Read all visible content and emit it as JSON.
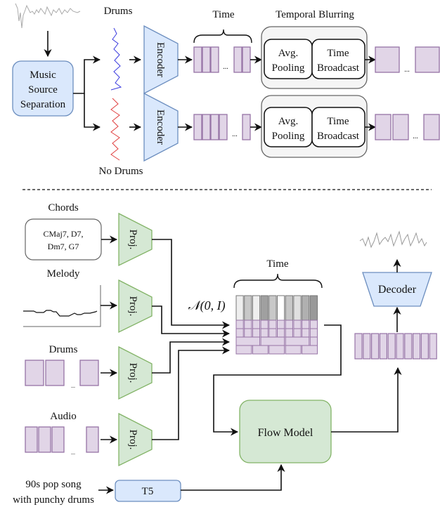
{
  "top": {
    "mixture_waveform": "waveform-gray",
    "separation_block": [
      "Music",
      "Source",
      "Separation"
    ],
    "drums_label": "Drums",
    "no_drums_label": "No Drums",
    "encoder_label": "Encoder",
    "time_label": "Time",
    "temporal_blurring_label": "Temporal Blurring",
    "avg_pooling": [
      "Avg.",
      "Pooling"
    ],
    "time_broadcast": [
      "Time",
      "Broadcast"
    ],
    "ellipsis": "...",
    "colors": {
      "drums_wave": "#3a3adf",
      "no_drums_wave": "#e04040"
    }
  },
  "bottom": {
    "chords_label": "Chords",
    "chords_text": [
      "CMaj7, D7,",
      "Dm7, G7"
    ],
    "melody_label": "Melody",
    "drums_label": "Drums",
    "audio_label": "Audio",
    "proj_label": "Proj.",
    "noise_label": "𝒩(0, I)",
    "time_label": "Time",
    "flow_model_label": "Flow Model",
    "decoder_label": "Decoder",
    "t5_label": "T5",
    "prompt_text": [
      "90s pop song",
      "with punchy drums"
    ],
    "ellipsis": "..."
  },
  "noise_column_shades": [
    "#eeeeee",
    "#c8c8c8",
    "#eeeeee",
    "#a0a0a0",
    "#c8c8c8",
    "#ffffff",
    "#c8c8c8",
    "#e0e0e0",
    "#b0b0b0",
    "#999999"
  ]
}
